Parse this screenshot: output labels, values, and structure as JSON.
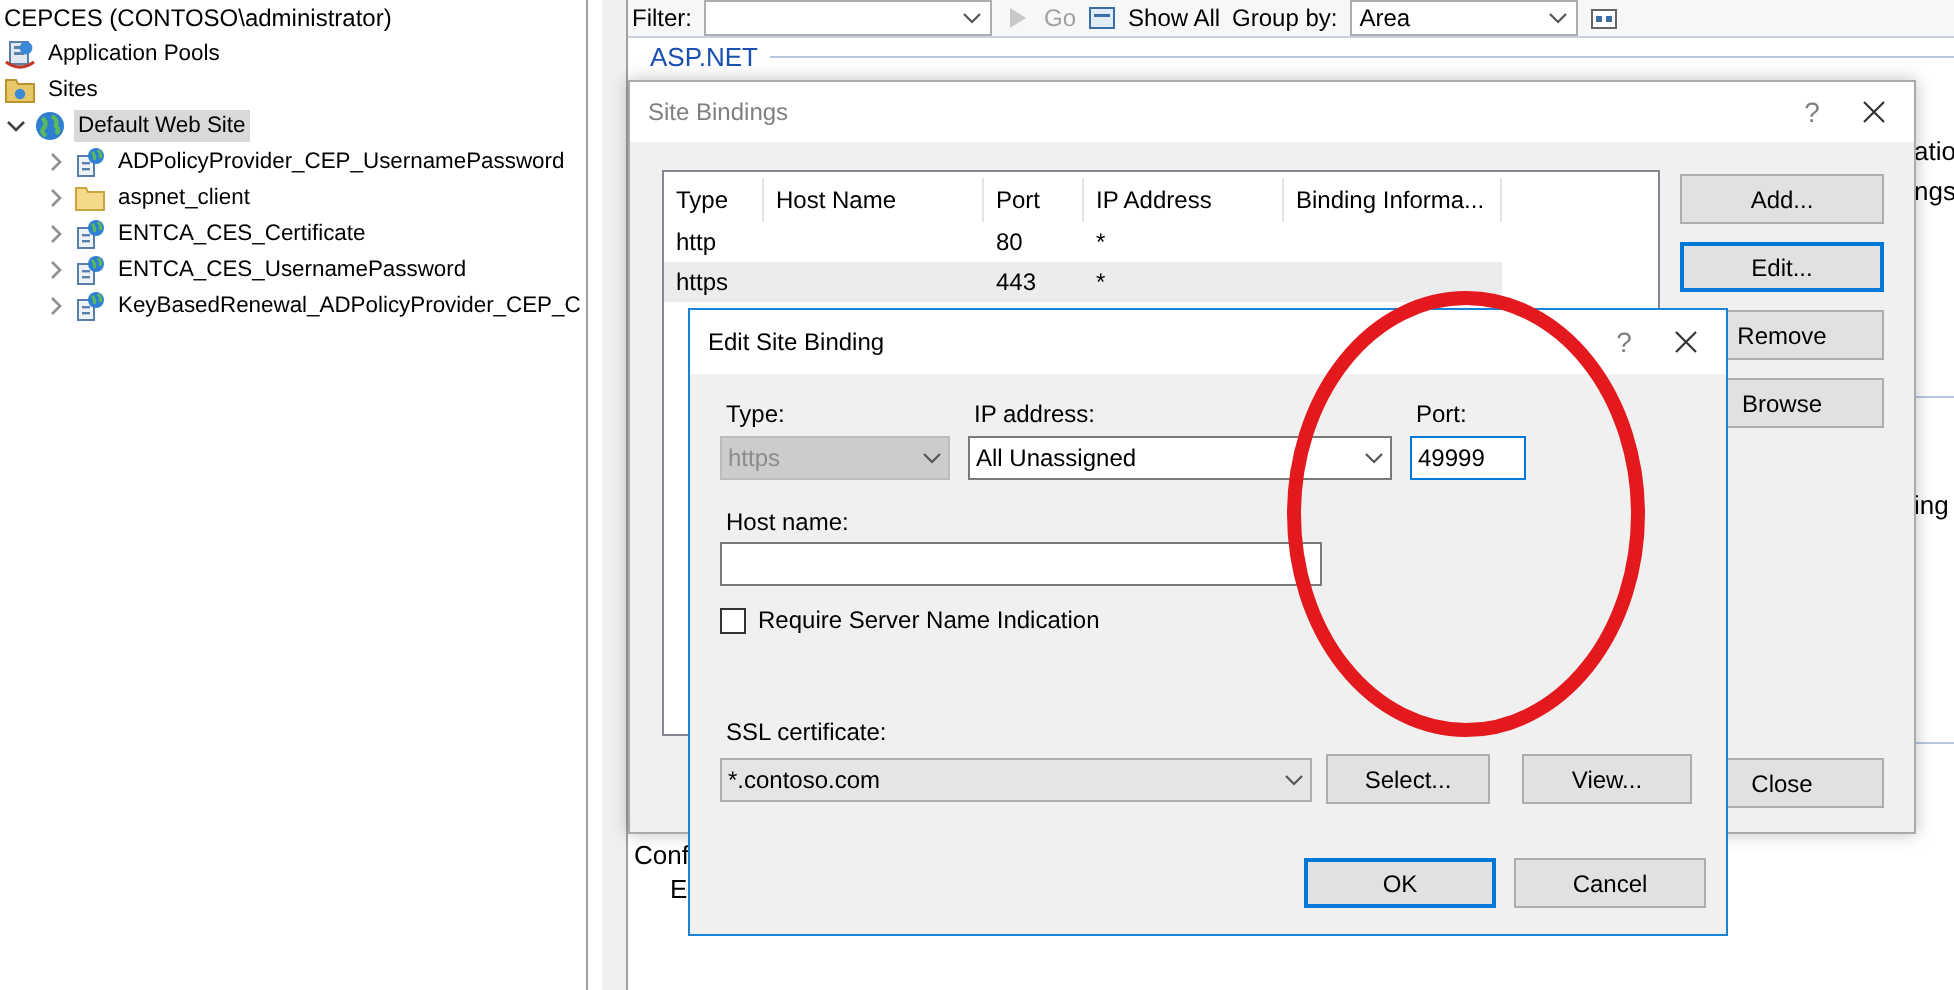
{
  "connections_tree": {
    "label": "CEPCES (CONTOSO\\administrator)",
    "children": [
      {
        "label": "Application Pools",
        "kind": "app-pools"
      },
      {
        "label": "Sites",
        "kind": "sites",
        "children": [
          {
            "label": "Default Web Site",
            "kind": "site",
            "expanded": true,
            "selected": true,
            "children": [
              {
                "label": "ADPolicyProvider_CEP_UsernamePassword",
                "kind": "application",
                "expanded": false,
                "selected": false
              },
              {
                "label": "aspnet_client",
                "kind": "folder",
                "expanded": false,
                "selected": false
              },
              {
                "label": "ENTCA_CES_Certificate",
                "kind": "application",
                "expanded": false,
                "selected": false
              },
              {
                "label": "ENTCA_CES_UsernamePassword",
                "kind": "application",
                "expanded": false,
                "selected": false
              },
              {
                "label": "KeyBasedRenewal_ADPolicyProvider_CEP_C",
                "kind": "application",
                "expanded": false,
                "selected": false
              }
            ]
          }
        ]
      }
    ]
  },
  "toolbar": {
    "filter_label": "Filter:",
    "go": "Go",
    "go_disabled": true,
    "show_all": "Show All",
    "group_by_label": "Group by:",
    "group_by_value": "Area"
  },
  "features": {
    "group": "ASP.NET",
    "right_fragments": [
      "atio",
      "ngs",
      "ing"
    ],
    "bottom_fragments": [
      "Conf",
      "E"
    ]
  },
  "site_bindings": {
    "title": "Site Bindings",
    "help": "?",
    "columns": [
      "Type",
      "Host Name",
      "Port",
      "IP Address",
      "Binding Informa..."
    ],
    "rows": [
      {
        "cells": [
          "http",
          "",
          "80",
          "*",
          ""
        ],
        "selected": false
      },
      {
        "cells": [
          "https",
          "",
          "443",
          "*",
          ""
        ],
        "selected": true
      }
    ],
    "buttons": [
      {
        "label": "Add...",
        "focused": false
      },
      {
        "label": "Edit...",
        "focused": true
      },
      {
        "label": "Remove",
        "focused": false
      },
      {
        "label": "Browse",
        "focused": false
      }
    ],
    "close_button": "Close"
  },
  "edit_site_binding": {
    "title": "Edit Site Binding",
    "help": "?",
    "type": {
      "label": "Type:",
      "value": "https",
      "disabled": true
    },
    "ip_address": {
      "label": "IP address:",
      "value": "All Unassigned"
    },
    "port": {
      "label": "Port:",
      "value": "49999"
    },
    "host_name": {
      "label": "Host name:"
    },
    "sni": {
      "label": "Require Server Name Indication",
      "checked": false
    },
    "ssl_certificate": {
      "label": "SSL certificate:",
      "value": "*.contoso.com"
    },
    "select_button": "Select...",
    "view_button": "View...",
    "ok_button": {
      "label": "OK",
      "focused": true
    },
    "cancel_button": {
      "label": "Cancel",
      "focused": false
    }
  }
}
